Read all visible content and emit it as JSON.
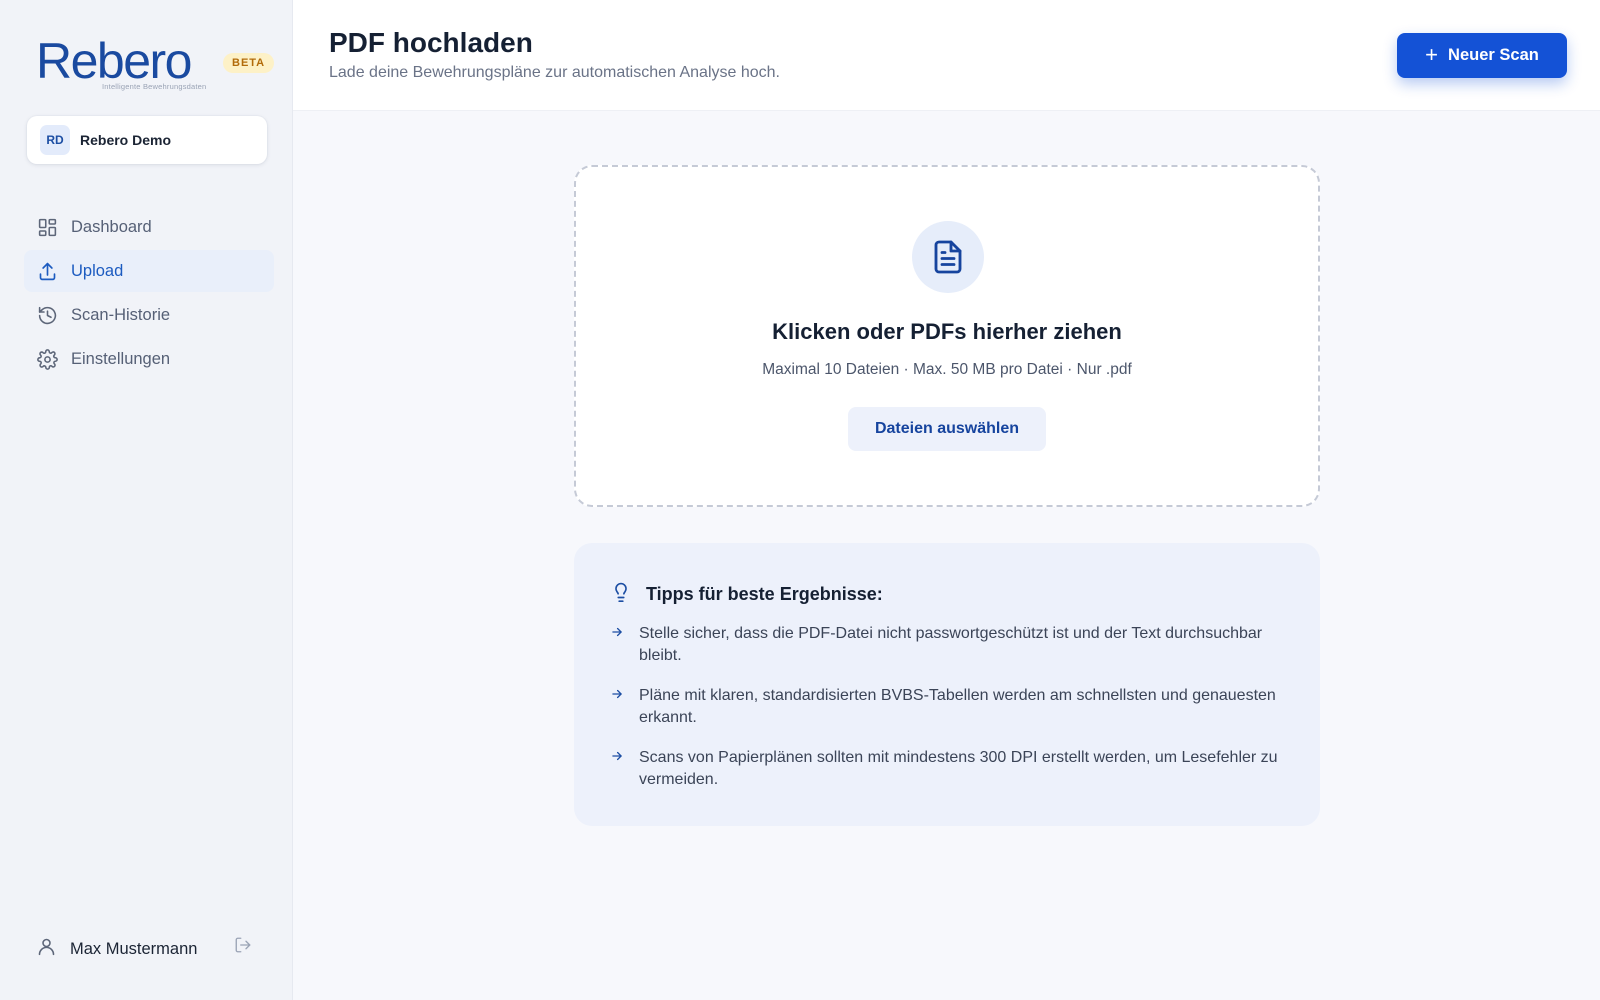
{
  "brand": {
    "name": "Rebero",
    "tagline": "Intelligente Bewehrungsdaten",
    "badge": "BETA"
  },
  "organization": {
    "initials": "RD",
    "name": "Rebero Demo"
  },
  "nav": {
    "items": [
      {
        "label": "Dashboard",
        "icon": "dashboard-icon"
      },
      {
        "label": "Upload",
        "icon": "upload-icon",
        "active": true
      },
      {
        "label": "Scan-Historie",
        "icon": "history-icon"
      },
      {
        "label": "Einstellungen",
        "icon": "gear-icon"
      }
    ]
  },
  "user": {
    "name": "Max Mustermann"
  },
  "header": {
    "title": "PDF hochladen",
    "subtitle": "Lade deine Bewehrungspläne zur automatischen Analyse hoch.",
    "new_scan_label": "Neuer Scan"
  },
  "dropzone": {
    "title": "Klicken oder PDFs hierher ziehen",
    "subtitle": "Maximal 10 Dateien · Max. 50 MB pro Datei · Nur .pdf",
    "button_label": "Dateien auswählen"
  },
  "tips": {
    "title": "Tipps für beste Ergebnisse:",
    "items": [
      "Stelle sicher, dass die PDF-Datei nicht passwortgeschützt ist und der Text durchsuchbar bleibt.",
      "Pläne mit klaren, standardisierten BVBS-Tabellen werden am schnellsten und genauesten erkannt.",
      "Scans von Papierplänen sollten mit mindestens 300 DPI erstellt werden, um Lesefehler zu vermeiden."
    ]
  },
  "colors": {
    "primary": "#1452d6",
    "brand": "#1a4aa0",
    "active_nav": "#1c5bc0",
    "badge_bg": "#fdf1c7",
    "badge_text": "#b26b0a"
  }
}
